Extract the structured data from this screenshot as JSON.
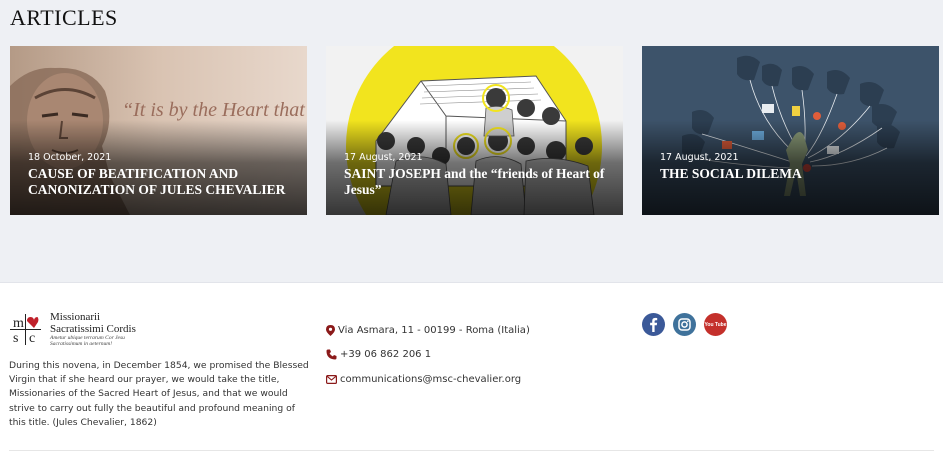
{
  "section": {
    "title": "ARTICLES"
  },
  "articles": [
    {
      "date": "18 October, 2021",
      "title": "CAUSE OF BEATIFICATION AND CANONIZATION OF JULES CHEVALIER",
      "image_quote": "“It is by the Heart that we are something.”"
    },
    {
      "date": "17 August, 2021",
      "title": "SAINT JOSEPH and the “friends of Heart of Jesus”"
    },
    {
      "date": "17 August, 2021",
      "title": "THE SOCIAL DILEMA"
    }
  ],
  "footer": {
    "logo": {
      "line1": "Missionarii",
      "line2": "Sacratissimi Cordis",
      "motto1": "Ametur ubique terrarum Cor Jesu",
      "motto2": "Sacratissimum in aeternum!",
      "mark": [
        "m",
        "s",
        "c"
      ]
    },
    "about": "During this novena, in December 1854, we promised the Blessed Virgin that if she heard our prayer, we would take the title, Missionaries of the Sacred Heart of Jesus, and that we would strive to carry out fully the beautiful and profound meaning of this title. (Jules Chevalier, 1862)",
    "contact": {
      "address": "Via Asmara, 11 - 00199 - Roma (Italia)",
      "phone": "+39 06 862 206 1",
      "email": "communications@msc-chevalier.org"
    },
    "social": [
      {
        "icon": "facebook-icon",
        "color": "#3b5998"
      },
      {
        "icon": "instagram-icon",
        "color": "#3f729b"
      },
      {
        "icon": "youtube-icon",
        "color": "#c4302b",
        "label": "You Tube"
      }
    ]
  },
  "colors": {
    "page_bg": "#eef0f4",
    "accent_red": "#8b1a1a",
    "yellow": "#f2e41e"
  }
}
